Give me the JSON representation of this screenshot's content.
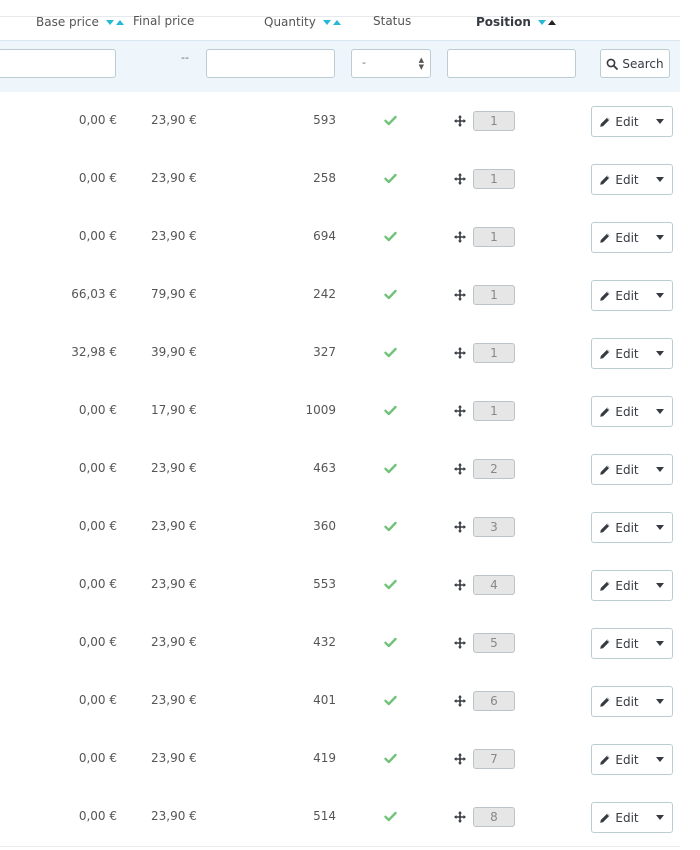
{
  "headers": {
    "base_price": "Base price",
    "final_price": "Final price",
    "quantity": "Quantity",
    "status": "Status",
    "position": "Position"
  },
  "filters": {
    "final_price_dash": "--",
    "status_select_value": "-",
    "search_label": "Search"
  },
  "edit_label": "Edit",
  "colors": {
    "accent": "#25b9d7",
    "check": "#72c279",
    "filter_bg": "#eef6fb"
  },
  "rows": [
    {
      "base": "0,00 €",
      "final": "23,90 €",
      "qty": "593",
      "position": "1"
    },
    {
      "base": "0,00 €",
      "final": "23,90 €",
      "qty": "258",
      "position": "1"
    },
    {
      "base": "0,00 €",
      "final": "23,90 €",
      "qty": "694",
      "position": "1"
    },
    {
      "base": "66,03 €",
      "final": "79,90 €",
      "qty": "242",
      "position": "1"
    },
    {
      "base": "32,98 €",
      "final": "39,90 €",
      "qty": "327",
      "position": "1"
    },
    {
      "base": "0,00 €",
      "final": "17,90 €",
      "qty": "1009",
      "position": "1"
    },
    {
      "base": "0,00 €",
      "final": "23,90 €",
      "qty": "463",
      "position": "2"
    },
    {
      "base": "0,00 €",
      "final": "23,90 €",
      "qty": "360",
      "position": "3"
    },
    {
      "base": "0,00 €",
      "final": "23,90 €",
      "qty": "553",
      "position": "4"
    },
    {
      "base": "0,00 €",
      "final": "23,90 €",
      "qty": "432",
      "position": "5"
    },
    {
      "base": "0,00 €",
      "final": "23,90 €",
      "qty": "401",
      "position": "6"
    },
    {
      "base": "0,00 €",
      "final": "23,90 €",
      "qty": "419",
      "position": "7"
    },
    {
      "base": "0,00 €",
      "final": "23,90 €",
      "qty": "514",
      "position": "8"
    }
  ]
}
